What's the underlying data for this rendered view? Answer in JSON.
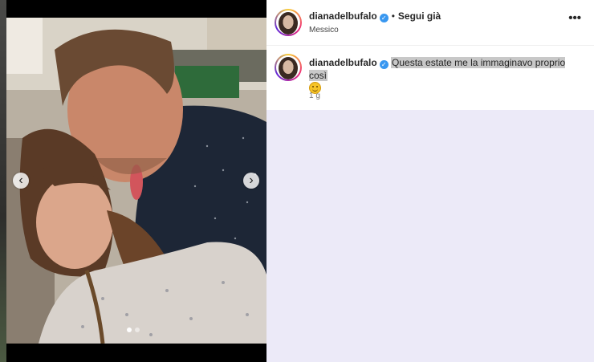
{
  "post": {
    "username": "dianadelbufalo",
    "follow_label": "Segui già",
    "location": "Messico",
    "caption": "Questa estate me la immaginavo proprio così",
    "time_ago": "1 g",
    "more_label": "•••"
  },
  "media": {
    "prev_label": "‹",
    "next_label": "›",
    "slide_count": 2,
    "current_slide": 1
  },
  "colors": {
    "verified": "#3897f0",
    "page_background": "#eceaf8"
  }
}
